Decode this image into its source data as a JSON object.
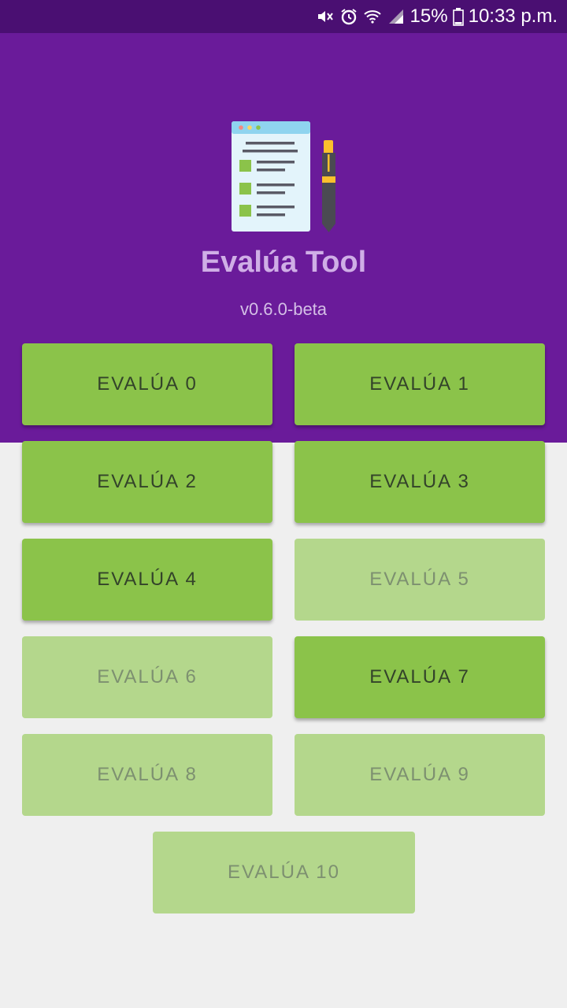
{
  "status_bar": {
    "battery": "15%",
    "time": "10:33 p.m.",
    "icons": [
      "mute-icon",
      "alarm-icon",
      "wifi-icon",
      "signal-icon",
      "battery-icon"
    ]
  },
  "header": {
    "icon": "checklist-pen-icon",
    "title": "Evalúa Tool",
    "version": "v0.6.0-beta"
  },
  "colors": {
    "primary": "#6a1b9a",
    "status_bar": "#4a0f72",
    "button_enabled": "#8bc34a",
    "button_disabled": "#b4d78c",
    "background": "#efefef"
  },
  "buttons": [
    {
      "label": "EVALÚA 0",
      "enabled": true
    },
    {
      "label": "EVALÚA 1",
      "enabled": true
    },
    {
      "label": "EVALÚA 2",
      "enabled": true
    },
    {
      "label": "EVALÚA 3",
      "enabled": true
    },
    {
      "label": "EVALÚA 4",
      "enabled": true
    },
    {
      "label": "EVALÚA 5",
      "enabled": false
    },
    {
      "label": "EVALÚA 6",
      "enabled": false
    },
    {
      "label": "EVALÚA 7",
      "enabled": true
    },
    {
      "label": "EVALÚA 8",
      "enabled": false
    },
    {
      "label": "EVALÚA 9",
      "enabled": false
    },
    {
      "label": "EVALÚA 10",
      "enabled": false
    }
  ]
}
